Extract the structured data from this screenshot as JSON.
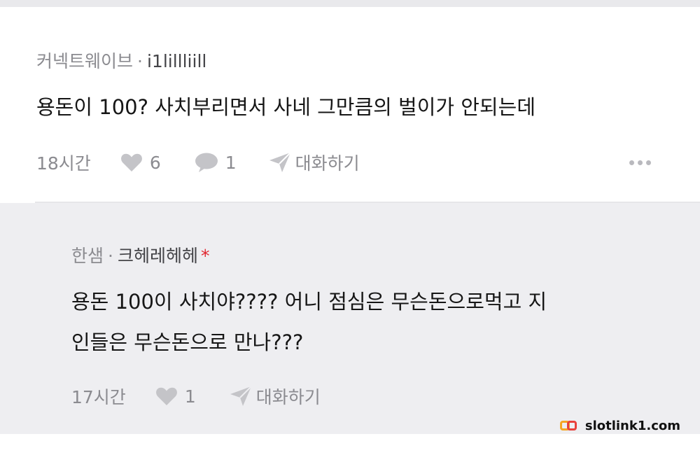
{
  "comment": {
    "community": "커넥트웨이브",
    "separator": "·",
    "nickname": "i1lillliill",
    "body": "용돈이 100? 사치부리면서 사네 그만큼의 벌이가 안되는데",
    "time": "18시간",
    "likes": "6",
    "replies": "1",
    "dm_label": "대화하기"
  },
  "reply": {
    "community": "한샘",
    "separator": "·",
    "nickname": "크헤레헤헤",
    "author_mark": "*",
    "body_lines": [
      "용돈 100이 사치야???? 어니 점심은 무슨돈으로먹고 지",
      "인들은 무슨돈으로 만나???"
    ],
    "time": "17시간",
    "likes": "1",
    "dm_label": "대화하기"
  },
  "watermark": {
    "text": "slotlink1.com"
  },
  "icons": {
    "like": "heart-icon",
    "reply": "speech-bubble-icon",
    "dm": "send-icon",
    "more": "more-dots-icon"
  },
  "colors": {
    "meta_text": "#8b8b90",
    "body_text": "#161616",
    "reply_background": "#eeeef1",
    "author_mark": "#e0262f",
    "icon_gray": "#c4c4c8"
  }
}
